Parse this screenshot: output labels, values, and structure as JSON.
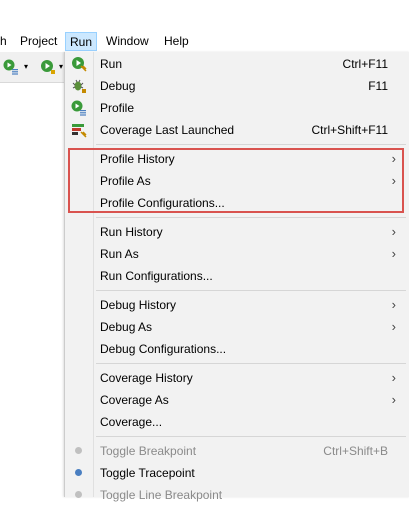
{
  "menubar": {
    "items": [
      {
        "label": "h"
      },
      {
        "label": "Project"
      },
      {
        "label": "Run"
      },
      {
        "label": "Window"
      },
      {
        "label": "Help"
      }
    ]
  },
  "toolbar": {
    "icons": [
      "profile-run-icon",
      "run-ext-icon"
    ],
    "dropdown_glyph": "▾"
  },
  "run_menu": {
    "items": [
      {
        "label": "Run",
        "shortcut": "Ctrl+F11",
        "icon": "run-icon"
      },
      {
        "label": "Debug",
        "shortcut": "F11",
        "icon": "debug-icon"
      },
      {
        "label": "Profile",
        "shortcut": "",
        "icon": "profile-icon"
      },
      {
        "label": "Coverage Last Launched",
        "shortcut": "Ctrl+Shift+F11",
        "icon": "coverage-icon"
      },
      {
        "label": "Profile History",
        "arrow": "›"
      },
      {
        "label": "Profile As",
        "arrow": "›"
      },
      {
        "label": "Profile Configurations..."
      },
      {
        "label": "Run History",
        "arrow": "›"
      },
      {
        "label": "Run As",
        "arrow": "›"
      },
      {
        "label": "Run Configurations..."
      },
      {
        "label": "Debug History",
        "arrow": "›"
      },
      {
        "label": "Debug As",
        "arrow": "›"
      },
      {
        "label": "Debug Configurations..."
      },
      {
        "label": "Coverage History",
        "arrow": "›"
      },
      {
        "label": "Coverage As",
        "arrow": "›"
      },
      {
        "label": "Coverage..."
      },
      {
        "label": "Toggle Breakpoint",
        "shortcut": "Ctrl+Shift+B",
        "disabled": true
      },
      {
        "label": "Toggle Tracepoint"
      },
      {
        "label": "Toggle Line Breakpoint",
        "disabled": true
      }
    ]
  },
  "colors": {
    "highlight_border": "#d9534f",
    "menu_active_bg": "#cce8ff",
    "menu_bg": "#f2f2f2",
    "dot_disabled": "#c0c0c0",
    "dot_active": "#4a7fc1"
  }
}
